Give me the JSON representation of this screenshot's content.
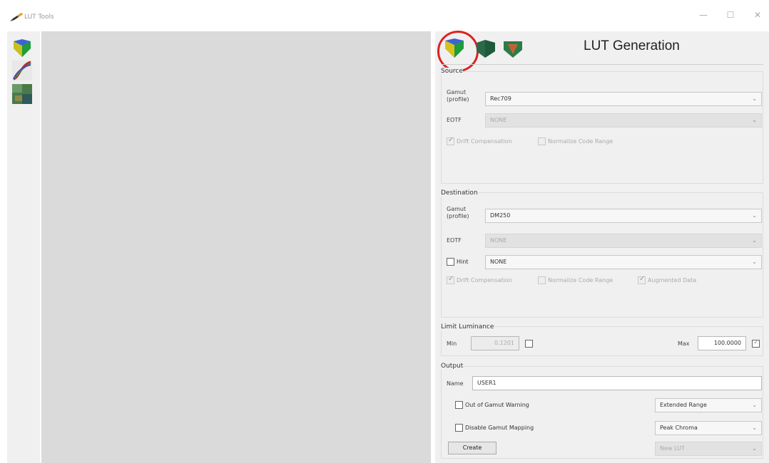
{
  "window": {
    "title": "LUT Tools",
    "minimize_glyph": "—",
    "maximize_glyph": "☐",
    "close_glyph": "✕"
  },
  "toolstrip": {
    "tools": [
      {
        "icon": "color-cube-icon"
      },
      {
        "icon": "tone-curve-icon"
      },
      {
        "icon": "image-map-icon"
      }
    ]
  },
  "panel": {
    "title": "LUT Generation",
    "mode_tabs": [
      {
        "icon": "color-cube-icon",
        "highlighted": true
      },
      {
        "icon": "cube-side-icon"
      },
      {
        "icon": "cube-gamut-icon"
      }
    ]
  },
  "source": {
    "label": "Source",
    "gamut_label_1": "Gamut",
    "gamut_label_2": "(profile)",
    "gamut_value": "Rec709",
    "eotf_label": "EOTF",
    "eotf_value": "NONE",
    "drift_label": "Drift Compensation",
    "normalize_label": "Normalize Code Range"
  },
  "destination": {
    "label": "Destination",
    "gamut_label_1": "Gamut",
    "gamut_label_2": "(profile)",
    "gamut_value": "DM250",
    "eotf_label": "EOTF",
    "eotf_value": "NONE",
    "hint_label": "Hint",
    "hint_value": "NONE",
    "drift_label": "Drift Compensation",
    "normalize_label": "Normalize Code Range",
    "augmented_label": "Augmented Data"
  },
  "luminance": {
    "label": "Limit Luminance",
    "min_label": "Min",
    "min_value": "0.1201",
    "max_label": "Max",
    "max_value": "100.0000"
  },
  "output": {
    "label": "Output",
    "name_label": "Name",
    "name_value": "USER1",
    "oog_label": "Out of Gamut Warning",
    "range_value": "Extended Range",
    "disable_mapping_label": "Disable Gamut Mapping",
    "mapping_value": "Peak Chroma",
    "create_label": "Create",
    "lut_value": "New LUT"
  },
  "colors": {
    "highlight": "#d22222",
    "canvas": "#dadada",
    "panel": "#f0f0f0"
  }
}
